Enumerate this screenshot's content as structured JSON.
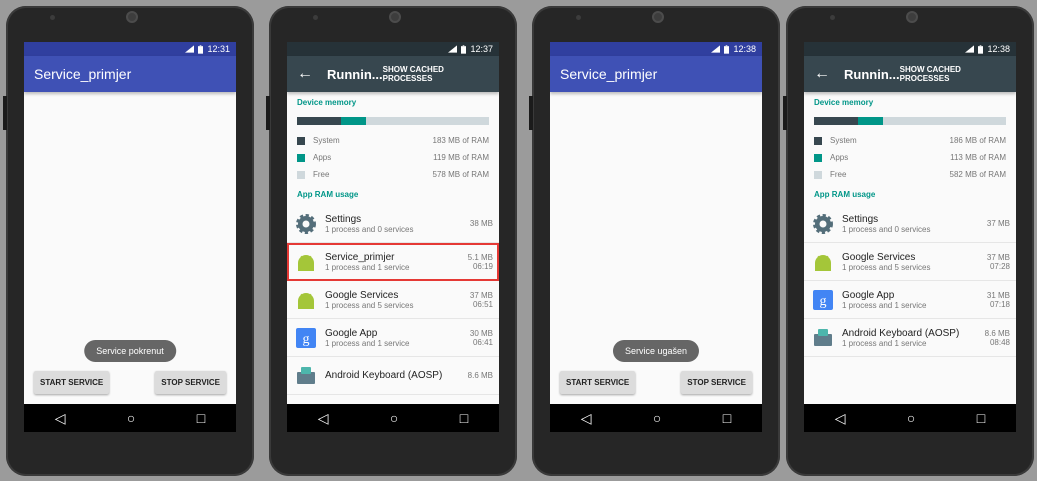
{
  "status_icons": {
    "signal": "signal-icon",
    "battery": "battery-icon"
  },
  "colors": {
    "primary": "#3f51b5",
    "primary_dark": "#303f9f",
    "settings_bar": "#37474f",
    "accent": "#009688",
    "highlight": "#e53935"
  },
  "nav": {
    "back": "◁",
    "home": "○",
    "recents": "□"
  },
  "phones": [
    {
      "time": "12:31",
      "title": "Service_primjer",
      "toast": "Service pokrenut",
      "start_label": "START SERVICE",
      "stop_label": "STOP SERVICE"
    },
    {
      "time": "12:37",
      "title": "Runnin...",
      "action": "SHOW CACHED PROCESSES",
      "device_memory": "Device memory",
      "memory": {
        "system_fraction": 0.23,
        "apps_fraction": 0.13,
        "rows": [
          {
            "label": "System",
            "value": "183 MB of RAM"
          },
          {
            "label": "Apps",
            "value": "119 MB of RAM"
          },
          {
            "label": "Free",
            "value": "578 MB of RAM"
          }
        ]
      },
      "app_ram_usage": "App RAM usage",
      "apps": [
        {
          "name": "Settings",
          "sub": "1 process and 0 services",
          "size": "38 MB",
          "time": "",
          "icon": "gear-icon"
        },
        {
          "name": "Service_primjer",
          "sub": "1 process and 1 service",
          "size": "5.1 MB",
          "time": "06:19",
          "icon": "android-icon"
        },
        {
          "name": "Google Services",
          "sub": "1 process and 5 services",
          "size": "37 MB",
          "time": "06:51",
          "icon": "android-icon"
        },
        {
          "name": "Google App",
          "sub": "1 process and 1 service",
          "size": "30 MB",
          "time": "06:41",
          "icon": "google-icon"
        },
        {
          "name": "Android Keyboard (AOSP)",
          "sub": "",
          "size": "8.6 MB",
          "time": "",
          "icon": "keyboard-icon"
        }
      ]
    },
    {
      "time": "12:38",
      "title": "Service_primjer",
      "toast": "Service ugašen",
      "start_label": "START SERVICE",
      "stop_label": "STOP SERVICE"
    },
    {
      "time": "12:38",
      "title": "Runnin...",
      "action": "SHOW CACHED PROCESSES",
      "device_memory": "Device memory",
      "memory": {
        "system_fraction": 0.23,
        "apps_fraction": 0.13,
        "rows": [
          {
            "label": "System",
            "value": "186 MB of RAM"
          },
          {
            "label": "Apps",
            "value": "113 MB of RAM"
          },
          {
            "label": "Free",
            "value": "582 MB of RAM"
          }
        ]
      },
      "app_ram_usage": "App RAM usage",
      "apps": [
        {
          "name": "Settings",
          "sub": "1 process and 0 services",
          "size": "37 MB",
          "time": "",
          "icon": "gear-icon"
        },
        {
          "name": "Google Services",
          "sub": "1 process and 5 services",
          "size": "37 MB",
          "time": "07:28",
          "icon": "android-icon"
        },
        {
          "name": "Google App",
          "sub": "1 process and 1 service",
          "size": "31 MB",
          "time": "07:18",
          "icon": "google-icon"
        },
        {
          "name": "Android Keyboard (AOSP)",
          "sub": "1 process and 1 service",
          "size": "8.6 MB",
          "time": "08:48",
          "icon": "keyboard-icon"
        }
      ]
    }
  ]
}
